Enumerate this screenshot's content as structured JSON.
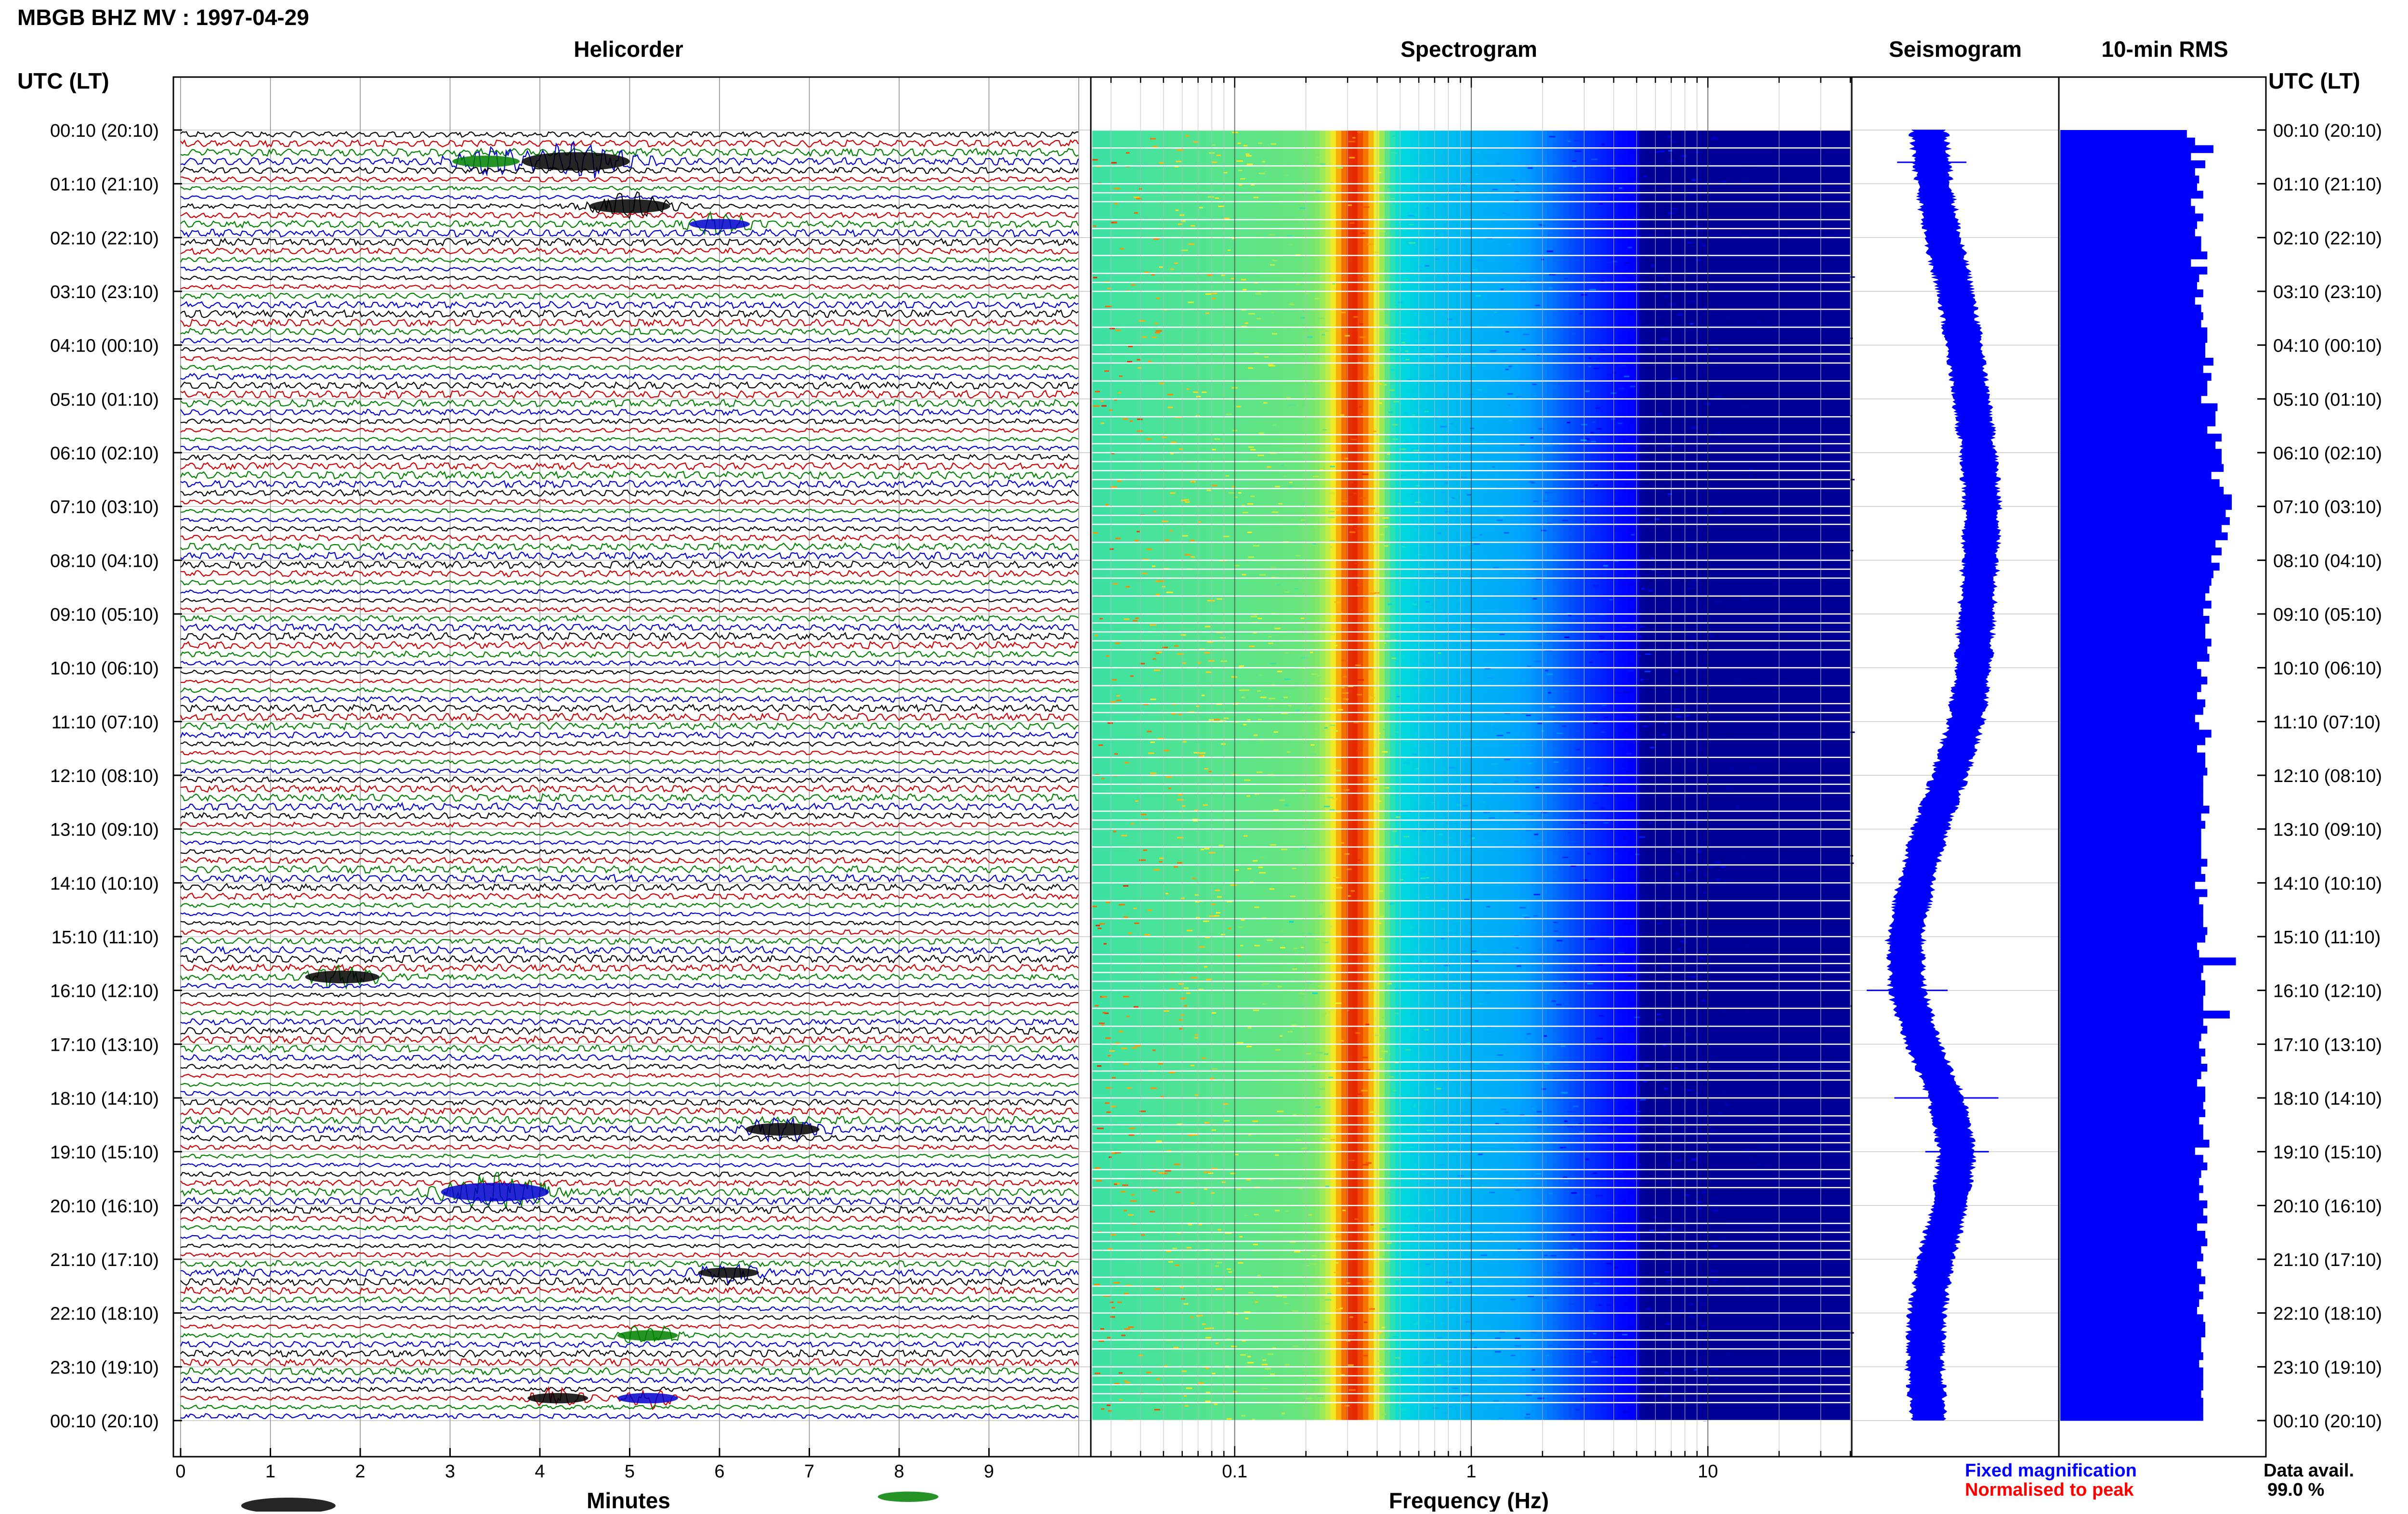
{
  "header": {
    "title": "MBGB BHZ MV : 1997-04-29",
    "utc_label_left": "UTC (LT)",
    "utc_label_right": "UTC (LT)"
  },
  "panels": {
    "helicorder": {
      "title": "Helicorder",
      "xlabel": "Minutes"
    },
    "spectrogram": {
      "title": "Spectrogram",
      "xlabel": "Frequency (Hz)"
    },
    "seismogram": {
      "title": "Seismogram"
    },
    "rms": {
      "title": "10-min RMS"
    }
  },
  "legend": {
    "fixed_magnification": "Fixed magnification",
    "normalised_to_peak": "Normalised to peak",
    "fixed_color": "#0000ff",
    "normalised_color": "#ff0000",
    "data_avail_label": "Data avail.",
    "data_avail_value": "99.0 %"
  },
  "colors": {
    "trace_colors": [
      "#000000",
      "#cc0000",
      "#008000",
      "#0000cc"
    ],
    "seismogram": "#0000ff",
    "rms_bar": "#0000ff"
  },
  "chart_data": {
    "type": "table",
    "time_labels": [
      "00:10 (20:10)",
      "01:10 (21:10)",
      "02:10 (22:10)",
      "03:10 (23:10)",
      "04:10 (00:10)",
      "05:10 (01:10)",
      "06:10 (02:10)",
      "07:10 (03:10)",
      "08:10 (04:10)",
      "09:10 (05:10)",
      "10:10 (06:10)",
      "11:10 (07:10)",
      "12:10 (08:10)",
      "13:10 (09:10)",
      "14:10 (10:10)",
      "15:10 (11:10)",
      "16:10 (12:10)",
      "17:10 (13:10)",
      "18:10 (14:10)",
      "19:10 (15:10)",
      "20:10 (16:10)",
      "21:10 (17:10)",
      "22:10 (18:10)",
      "23:10 (19:10)",
      "00:10 (20:10)"
    ],
    "helicorder": {
      "x_ticks": [
        "0",
        "1",
        "2",
        "3",
        "4",
        "5",
        "6",
        "7",
        "8",
        "9"
      ],
      "xlim": [
        0,
        10
      ],
      "events": [
        {
          "minute": 4.4,
          "row": 3,
          "color": "#000000",
          "size": 1.6
        },
        {
          "minute": 3.4,
          "row": 3,
          "color": "#008000",
          "size": 1.0
        },
        {
          "minute": 5.0,
          "row": 8,
          "color": "#000000",
          "size": 1.2
        },
        {
          "minute": 6.0,
          "row": 10,
          "color": "#0000cc",
          "size": 0.9
        },
        {
          "minute": 1.8,
          "row": 94,
          "color": "#000000",
          "size": 1.1
        },
        {
          "minute": 6.7,
          "row": 111,
          "color": "#000000",
          "size": 1.1
        },
        {
          "minute": 3.5,
          "row": 118,
          "color": "#0000cc",
          "size": 1.6
        },
        {
          "minute": 6.1,
          "row": 127,
          "color": "#000000",
          "size": 0.9
        },
        {
          "minute": 5.2,
          "row": 134,
          "color": "#008000",
          "size": 0.9
        },
        {
          "minute": 4.2,
          "row": 141,
          "color": "#000000",
          "size": 0.9
        },
        {
          "minute": 5.2,
          "row": 141,
          "color": "#0000cc",
          "size": 0.9
        },
        {
          "minute": 1.2,
          "row": 153,
          "color": "#000000",
          "size": 1.4
        },
        {
          "minute": 8.1,
          "row": 152,
          "color": "#008000",
          "size": 0.9
        }
      ]
    },
    "spectrogram": {
      "x_ticks": [
        "0.1",
        "1",
        "10"
      ],
      "x_scale": "log",
      "xlim_hz": [
        0.025,
        40
      ],
      "data_max_hz": 40,
      "peak_hz": 0.33,
      "peak_width_log": 0.1,
      "secondary_peak_hz": 1.6
    },
    "seismogram": {
      "drift": [
        0.3,
        0.24,
        0.14,
        0.0,
        -0.1,
        -0.18,
        -0.26,
        -0.3,
        -0.28,
        -0.24,
        -0.2,
        -0.12,
        0.06,
        0.28,
        0.44,
        0.56,
        0.54,
        0.36,
        0.1,
        -0.02,
        0.06,
        0.22,
        0.32,
        0.34,
        0.3
      ],
      "spikes": [
        {
          "hour": 0.6,
          "amp": 0.7
        },
        {
          "hour": 18.0,
          "amp": 1.3
        },
        {
          "hour": 16.0,
          "amp": 0.9
        },
        {
          "hour": 19.0,
          "amp": 0.6
        }
      ]
    },
    "rms": {
      "values": [
        0.62,
        0.66,
        0.75,
        0.64,
        0.71,
        0.66,
        0.68,
        0.67,
        0.7,
        0.64,
        0.66,
        0.7,
        0.67,
        0.66,
        0.69,
        0.69,
        0.72,
        0.64,
        0.72,
        0.68,
        0.67,
        0.7,
        0.66,
        0.69,
        0.7,
        0.69,
        0.72,
        0.72,
        0.71,
        0.71,
        0.75,
        0.7,
        0.74,
        0.72,
        0.72,
        0.69,
        0.77,
        0.76,
        0.76,
        0.72,
        0.79,
        0.76,
        0.79,
        0.79,
        0.8,
        0.74,
        0.78,
        0.8,
        0.84,
        0.84,
        0.81,
        0.83,
        0.79,
        0.82,
        0.76,
        0.79,
        0.74,
        0.78,
        0.75,
        0.74,
        0.73,
        0.71,
        0.74,
        0.7,
        0.73,
        0.71,
        0.71,
        0.74,
        0.72,
        0.73,
        0.67,
        0.69,
        0.72,
        0.69,
        0.67,
        0.71,
        0.7,
        0.66,
        0.68,
        0.74,
        0.71,
        0.67,
        0.71,
        0.71,
        0.72,
        0.7,
        0.7,
        0.7,
        0.7,
        0.73,
        0.69,
        0.71,
        0.69,
        0.69,
        0.69,
        0.69,
        0.72,
        0.69,
        0.71,
        0.66,
        0.72,
        0.68,
        0.7,
        0.7,
        0.7,
        0.72,
        0.71,
        0.67,
        0.68,
        0.86,
        0.7,
        0.69,
        0.71,
        0.71,
        0.7,
        0.7,
        0.83,
        0.7,
        0.72,
        0.69,
        0.68,
        0.71,
        0.69,
        0.72,
        0.69,
        0.67,
        0.71,
        0.71,
        0.7,
        0.71,
        0.68,
        0.7,
        0.7,
        0.73,
        0.66,
        0.7,
        0.72,
        0.69,
        0.68,
        0.7,
        0.68,
        0.72,
        0.7,
        0.72,
        0.67,
        0.71,
        0.72,
        0.69,
        0.7,
        0.67,
        0.69,
        0.71,
        0.68,
        0.7,
        0.68,
        0.67,
        0.7,
        0.71,
        0.71,
        0.69,
        0.69,
        0.7,
        0.68,
        0.7,
        0.7,
        0.7,
        0.69,
        0.7,
        0.7,
        0.7
      ],
      "xlim": [
        0,
        1
      ]
    }
  }
}
